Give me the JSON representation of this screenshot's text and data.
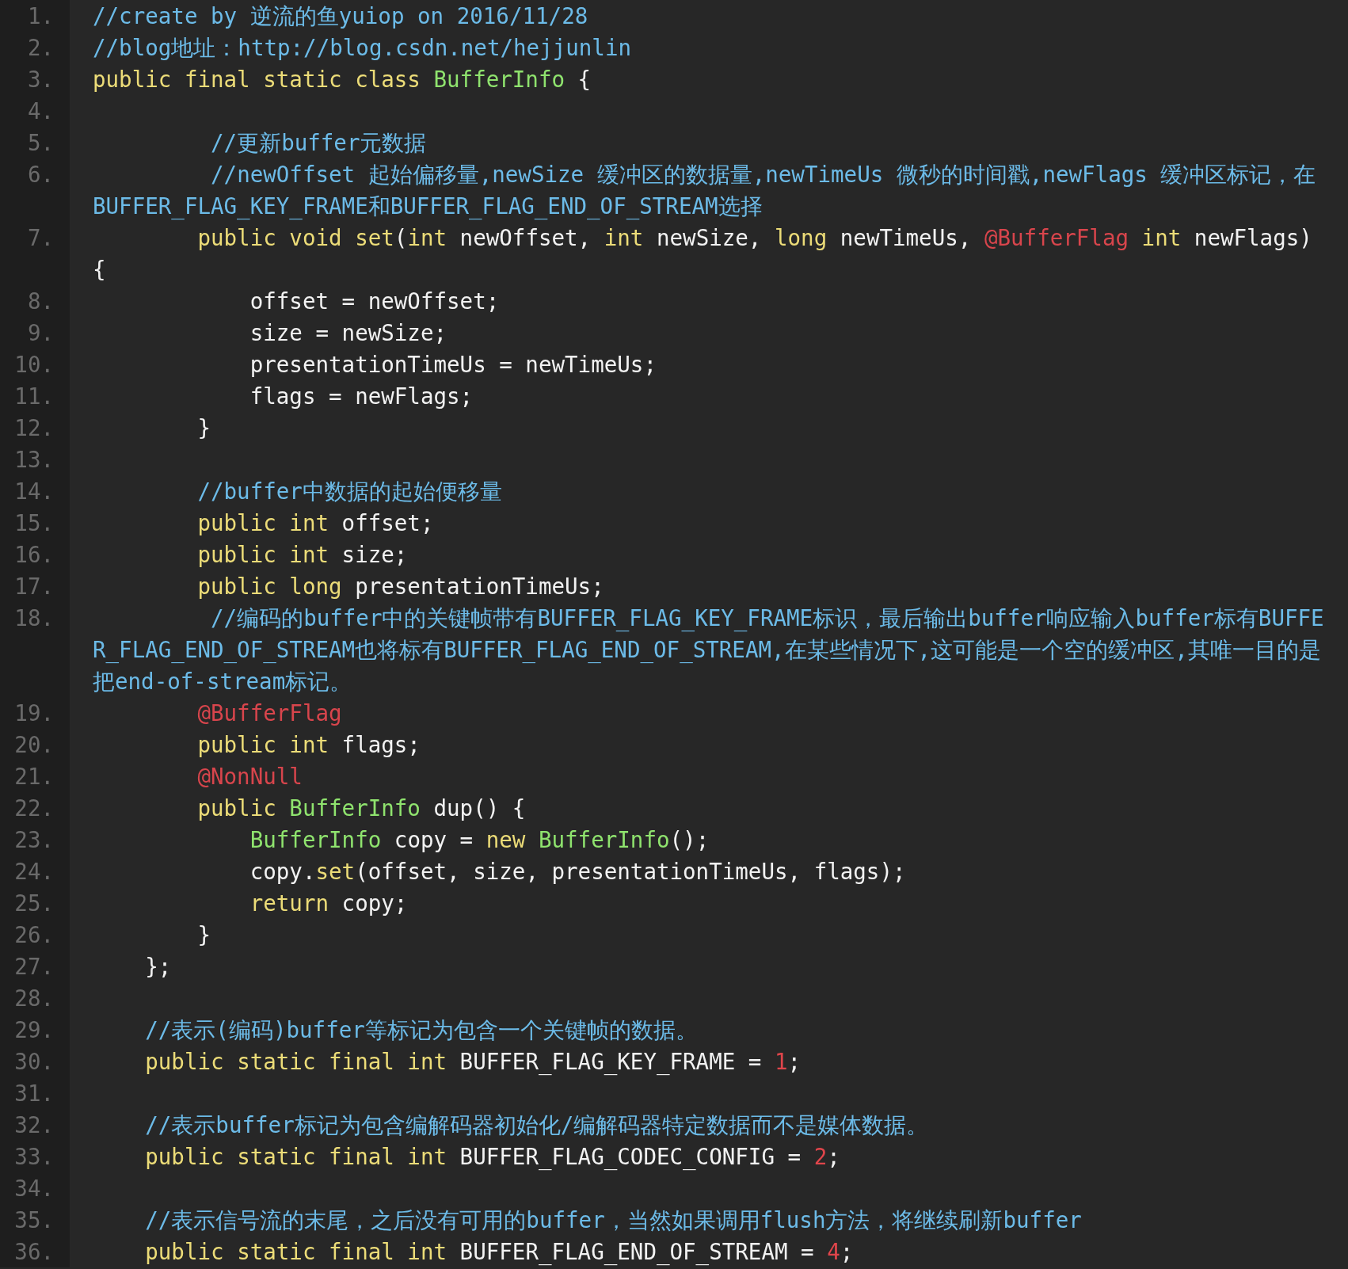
{
  "code_lines": [
    {
      "number": "1.",
      "tokens": [
        {
          "kind": "comment",
          "text": "//create by 逆流的鱼yuiop on 2016/11/28"
        }
      ]
    },
    {
      "number": "2.",
      "tokens": [
        {
          "kind": "comment",
          "text": "//blog地址：http://blog.csdn.net/hejjunlin"
        }
      ]
    },
    {
      "number": "3.",
      "tokens": [
        {
          "kind": "keyword",
          "text": "public final static class "
        },
        {
          "kind": "type",
          "text": "BufferInfo"
        },
        {
          "kind": "plain",
          "text": " {"
        }
      ]
    },
    {
      "number": "4."
    },
    {
      "number": "5.",
      "tokens": [
        {
          "kind": "comment",
          "text": "         //更新buffer元数据"
        }
      ]
    },
    {
      "number": "6.",
      "tokens": [
        {
          "kind": "comment",
          "text": "         //newOffset 起始偏移量,newSize 缓冲区的数据量,newTimeUs 微秒的时间戳,newFlags 缓冲区标记，在BUFFER_FLAG_KEY_FRAME和BUFFER_FLAG_END_OF_STREAM选择"
        }
      ]
    },
    {
      "number": "7.",
      "tokens": [
        {
          "kind": "keyword",
          "text": "        public void set"
        },
        {
          "kind": "plain",
          "text": "("
        },
        {
          "kind": "keyword",
          "text": "int"
        },
        {
          "kind": "plain",
          "text": " newOffset, "
        },
        {
          "kind": "keyword",
          "text": "int"
        },
        {
          "kind": "plain",
          "text": " newSize, "
        },
        {
          "kind": "keyword",
          "text": "long"
        },
        {
          "kind": "plain",
          "text": " newTimeUs, "
        },
        {
          "kind": "annotation",
          "text": "@BufferFlag"
        },
        {
          "kind": "keyword",
          "text": " int"
        },
        {
          "kind": "plain",
          "text": " newFlags) {"
        }
      ]
    },
    {
      "number": "8.",
      "tokens": [
        {
          "kind": "plain",
          "text": "            offset = newOffset;"
        }
      ]
    },
    {
      "number": "9.",
      "tokens": [
        {
          "kind": "plain",
          "text": "            size = newSize;"
        }
      ]
    },
    {
      "number": "10.",
      "tokens": [
        {
          "kind": "plain",
          "text": "            presentationTimeUs = newTimeUs;"
        }
      ]
    },
    {
      "number": "11.",
      "tokens": [
        {
          "kind": "plain",
          "text": "            flags = newFlags;"
        }
      ]
    },
    {
      "number": "12.",
      "tokens": [
        {
          "kind": "plain",
          "text": "        }"
        }
      ]
    },
    {
      "number": "13."
    },
    {
      "number": "14.",
      "tokens": [
        {
          "kind": "comment",
          "text": "        //buffer中数据的起始便移量"
        }
      ]
    },
    {
      "number": "15.",
      "tokens": [
        {
          "kind": "keyword",
          "text": "        public int"
        },
        {
          "kind": "plain",
          "text": " offset;"
        }
      ]
    },
    {
      "number": "16.",
      "tokens": [
        {
          "kind": "keyword",
          "text": "        public int"
        },
        {
          "kind": "plain",
          "text": " size;"
        }
      ]
    },
    {
      "number": "17.",
      "tokens": [
        {
          "kind": "keyword",
          "text": "        public long"
        },
        {
          "kind": "plain",
          "text": " presentationTimeUs;"
        }
      ]
    },
    {
      "number": "18.",
      "tokens": [
        {
          "kind": "comment",
          "text": "         //编码的buffer中的关键帧带有BUFFER_FLAG_KEY_FRAME标识，最后输出buffer响应输入buffer标有BUFFER_FLAG_END_OF_STREAM也将标有BUFFER_FLAG_END_OF_STREAM,在某些情况下,这可能是一个空的缓冲区,其唯一目的是把end-of-stream标记。"
        }
      ]
    },
    {
      "number": "19.",
      "tokens": [
        {
          "kind": "annotation",
          "text": "        @BufferFlag"
        }
      ]
    },
    {
      "number": "20.",
      "tokens": [
        {
          "kind": "keyword",
          "text": "        public int"
        },
        {
          "kind": "plain",
          "text": " flags;"
        }
      ]
    },
    {
      "number": "21.",
      "tokens": [
        {
          "kind": "annotation",
          "text": "        @NonNull"
        }
      ]
    },
    {
      "number": "22.",
      "tokens": [
        {
          "kind": "keyword",
          "text": "        public "
        },
        {
          "kind": "type",
          "text": "BufferInfo"
        },
        {
          "kind": "plain",
          "text": " dup() {"
        }
      ]
    },
    {
      "number": "23.",
      "tokens": [
        {
          "kind": "type",
          "text": "            BufferInfo"
        },
        {
          "kind": "plain",
          "text": " copy = "
        },
        {
          "kind": "keyword",
          "text": "new "
        },
        {
          "kind": "type",
          "text": "BufferInfo"
        },
        {
          "kind": "plain",
          "text": "();"
        }
      ]
    },
    {
      "number": "24.",
      "tokens": [
        {
          "kind": "plain",
          "text": "            copy."
        },
        {
          "kind": "keyword",
          "text": "set"
        },
        {
          "kind": "plain",
          "text": "(offset, size, presentationTimeUs, flags);"
        }
      ]
    },
    {
      "number": "25.",
      "tokens": [
        {
          "kind": "keyword",
          "text": "            return"
        },
        {
          "kind": "plain",
          "text": " copy;"
        }
      ]
    },
    {
      "number": "26.",
      "tokens": [
        {
          "kind": "plain",
          "text": "        }"
        }
      ]
    },
    {
      "number": "27.",
      "tokens": [
        {
          "kind": "plain",
          "text": "    };"
        }
      ]
    },
    {
      "number": "28."
    },
    {
      "number": "29.",
      "tokens": [
        {
          "kind": "comment",
          "text": "    //表示(编码)buffer等标记为包含一个关键帧的数据。"
        }
      ]
    },
    {
      "number": "30.",
      "tokens": [
        {
          "kind": "keyword",
          "text": "    public static final int"
        },
        {
          "kind": "plain",
          "text": " BUFFER_FLAG_KEY_FRAME = "
        },
        {
          "kind": "number",
          "text": "1"
        },
        {
          "kind": "plain",
          "text": ";"
        }
      ]
    },
    {
      "number": "31."
    },
    {
      "number": "32.",
      "tokens": [
        {
          "kind": "comment",
          "text": "    //表示buffer标记为包含编解码器初始化/编解码器特定数据而不是媒体数据。"
        }
      ]
    },
    {
      "number": "33.",
      "tokens": [
        {
          "kind": "keyword",
          "text": "    public static final int"
        },
        {
          "kind": "plain",
          "text": " BUFFER_FLAG_CODEC_CONFIG = "
        },
        {
          "kind": "number",
          "text": "2"
        },
        {
          "kind": "plain",
          "text": ";"
        }
      ]
    },
    {
      "number": "34."
    },
    {
      "number": "35.",
      "tokens": [
        {
          "kind": "comment",
          "text": "    //表示信号流的末尾，之后没有可用的buffer，当然如果调用flush方法，将继续刷新buffer"
        }
      ]
    },
    {
      "number": "36.",
      "tokens": [
        {
          "kind": "keyword",
          "text": "    public static final int"
        },
        {
          "kind": "plain",
          "text": " BUFFER_FLAG_END_OF_STREAM = "
        },
        {
          "kind": "number",
          "text": "4"
        },
        {
          "kind": "plain",
          "text": ";"
        }
      ]
    }
  ]
}
